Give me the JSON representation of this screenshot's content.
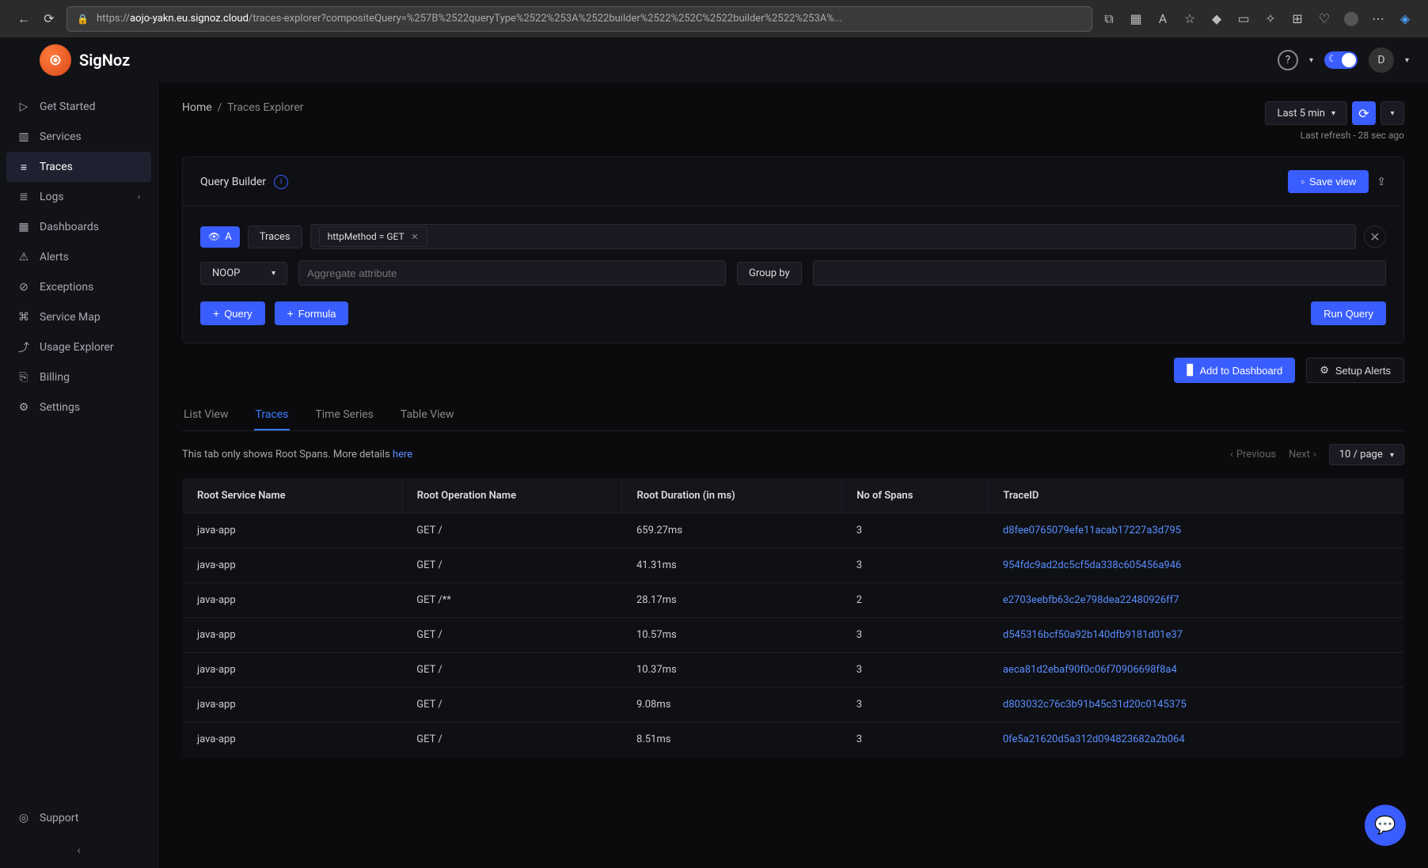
{
  "browser": {
    "url_host": "aojo-yakn.eu.signoz.cloud",
    "url_path": "/traces-explorer?compositeQuery=%257B%2522queryType%2522%253A%2522builder%2522%252C%2522builder%2522%253A%...",
    "url_prefix": "https://"
  },
  "brand": {
    "name": "SigNoz"
  },
  "sidebar": {
    "items": [
      {
        "label": "Get Started"
      },
      {
        "label": "Services"
      },
      {
        "label": "Traces"
      },
      {
        "label": "Logs"
      },
      {
        "label": "Dashboards"
      },
      {
        "label": "Alerts"
      },
      {
        "label": "Exceptions"
      },
      {
        "label": "Service Map"
      },
      {
        "label": "Usage Explorer"
      },
      {
        "label": "Billing"
      },
      {
        "label": "Settings"
      }
    ],
    "support": "Support"
  },
  "breadcrumb": {
    "home": "Home",
    "sep": "/",
    "current": "Traces Explorer"
  },
  "time": {
    "range": "Last 5 min",
    "last_refresh": "Last refresh - 28 sec ago"
  },
  "query_builder": {
    "title": "Query Builder",
    "save_view": "Save view",
    "badge": "A",
    "source": "Traces",
    "filter_tag": "httpMethod = GET",
    "noop": "NOOP",
    "agg_placeholder": "Aggregate attribute",
    "group_by": "Group by",
    "add_query": "Query",
    "add_formula": "Formula",
    "run_query": "Run Query"
  },
  "mid_actions": {
    "add_dashboard": "Add to Dashboard",
    "setup_alerts": "Setup Alerts"
  },
  "tabs": {
    "list_view": "List View",
    "traces": "Traces",
    "time_series": "Time Series",
    "table_view": "Table View"
  },
  "info": {
    "note_text": "This tab only shows Root Spans. More details ",
    "note_link": "here",
    "prev": "Previous",
    "next": "Next",
    "page_size": "10 / page"
  },
  "table": {
    "columns": {
      "service": "Root Service Name",
      "operation": "Root Operation Name",
      "duration": "Root Duration (in ms)",
      "spans": "No of Spans",
      "traceid": "TraceID"
    },
    "rows": [
      {
        "service": "java-app",
        "operation": "GET /",
        "duration": "659.27ms",
        "spans": "3",
        "traceid": "d8fee0765079efe11acab17227a3d795"
      },
      {
        "service": "java-app",
        "operation": "GET /",
        "duration": "41.31ms",
        "spans": "3",
        "traceid": "954fdc9ad2dc5cf5da338c605456a946"
      },
      {
        "service": "java-app",
        "operation": "GET /**",
        "duration": "28.17ms",
        "spans": "2",
        "traceid": "e2703eebfb63c2e798dea22480926ff7"
      },
      {
        "service": "java-app",
        "operation": "GET /",
        "duration": "10.57ms",
        "spans": "3",
        "traceid": "d545316bcf50a92b140dfb9181d01e37"
      },
      {
        "service": "java-app",
        "operation": "GET /",
        "duration": "10.37ms",
        "spans": "3",
        "traceid": "aeca81d2ebaf90f0c06f70906698f8a4"
      },
      {
        "service": "java-app",
        "operation": "GET /",
        "duration": "9.08ms",
        "spans": "3",
        "traceid": "d803032c76c3b91b45c31d20c0145375"
      },
      {
        "service": "java-app",
        "operation": "GET /",
        "duration": "8.51ms",
        "spans": "3",
        "traceid": "0fe5a21620d5a312d094823682a2b064"
      }
    ]
  },
  "user": {
    "initial": "D"
  }
}
